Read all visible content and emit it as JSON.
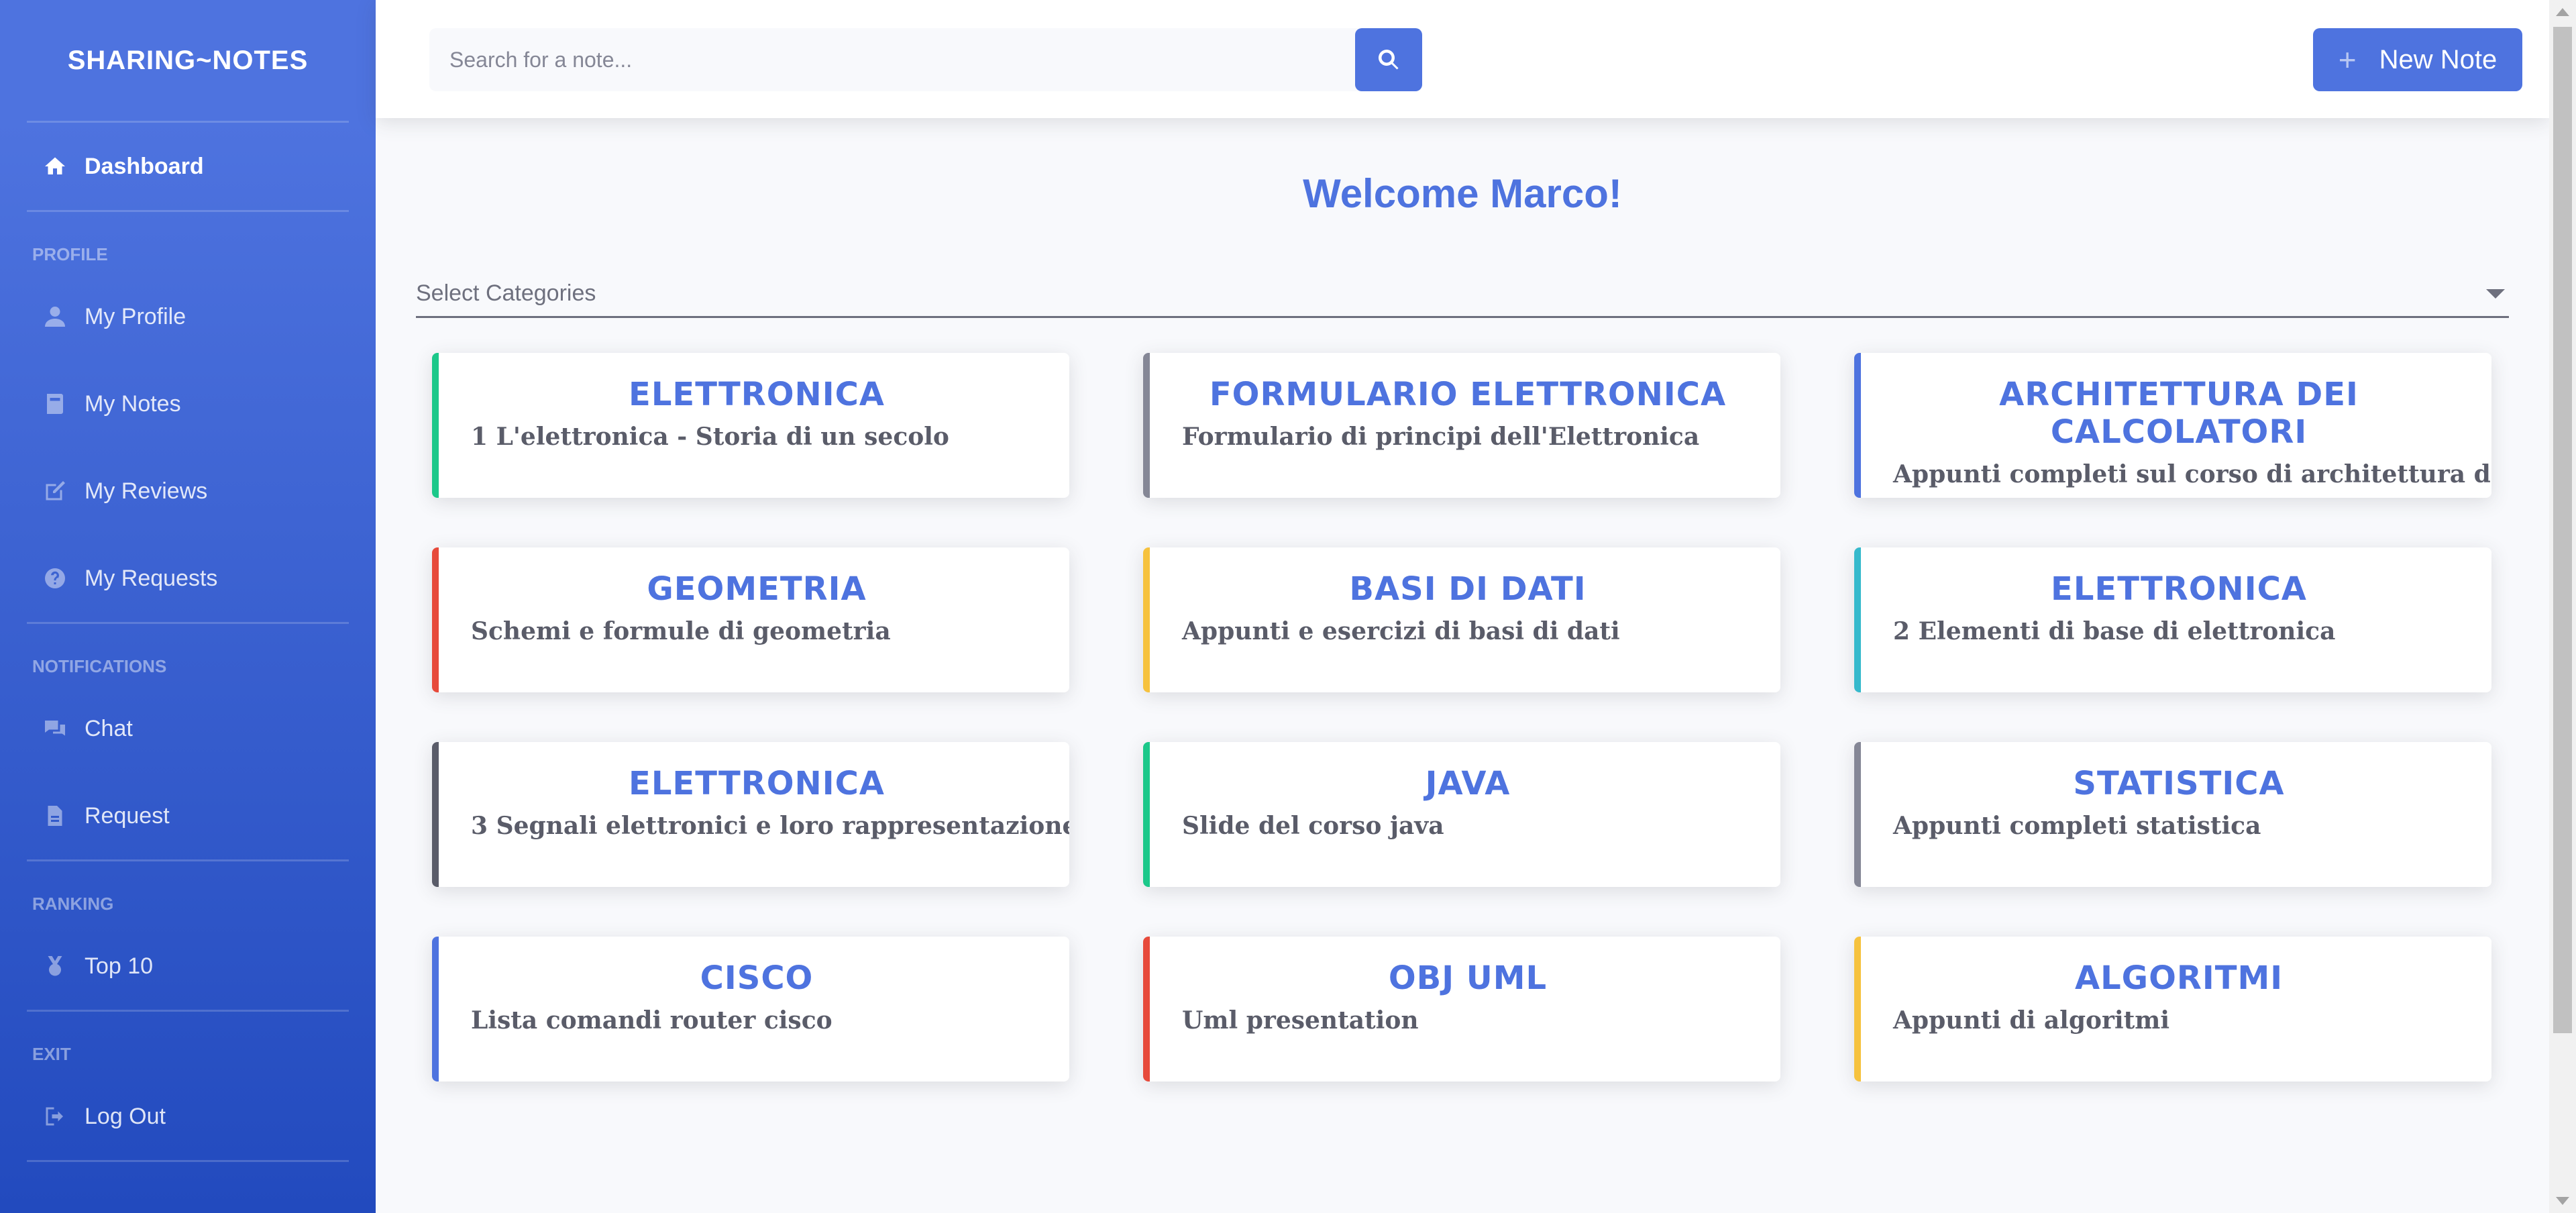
{
  "sidebar": {
    "brand": "SHARING~NOTES",
    "dashboard": {
      "label": "Dashboard",
      "icon": "home-icon"
    },
    "sections": [
      {
        "heading": "PROFILE"
      },
      {
        "heading": "NOTIFICATIONS"
      },
      {
        "heading": "RANKING"
      },
      {
        "heading": "EXIT"
      }
    ],
    "items": [
      {
        "label": "My Profile",
        "icon": "user-icon"
      },
      {
        "label": "My Notes",
        "icon": "book-icon"
      },
      {
        "label": "My Reviews",
        "icon": "edit-icon"
      },
      {
        "label": "My Requests",
        "icon": "question-circle-icon"
      },
      {
        "label": "Chat",
        "icon": "comments-icon"
      },
      {
        "label": "Request",
        "icon": "file-icon"
      },
      {
        "label": "Top 10",
        "icon": "medal-icon"
      },
      {
        "label": "Log Out",
        "icon": "sign-out-icon"
      }
    ]
  },
  "topbar": {
    "search_placeholder": "Search for a note...",
    "new_note_label": "New Note"
  },
  "main": {
    "welcome": "Welcome Marco!",
    "category_select": "Select Categories"
  },
  "cards": [
    {
      "title": "ELETTRONICA",
      "desc": "1 L'elettronica - Storia di un secolo",
      "accent": "#1cc88a"
    },
    {
      "title": "FORMULARIO ELETTRONICA",
      "desc": "Formulario di principi dell'Elettronica",
      "accent": "#858796"
    },
    {
      "title": "ARCHITETTURA DEI CALCOLATORI",
      "desc": "Appunti completi sul corso di architettura dei",
      "accent": "#4e73df"
    },
    {
      "title": "GEOMETRIA",
      "desc": "Schemi e formule di geometria",
      "accent": "#e74a3b"
    },
    {
      "title": "BASI DI DATI",
      "desc": "Appunti e esercizi di basi di dati",
      "accent": "#f6c23e"
    },
    {
      "title": "ELETTRONICA",
      "desc": "2 Elementi di base di elettronica",
      "accent": "#36b9cc"
    },
    {
      "title": "ELETTRONICA",
      "desc": "3 Segnali elettronici e loro rappresentazione",
      "accent": "#5a5c69"
    },
    {
      "title": "JAVA",
      "desc": "Slide del corso java",
      "accent": "#1cc88a"
    },
    {
      "title": "STATISTICA",
      "desc": "Appunti completi statistica",
      "accent": "#858796"
    },
    {
      "title": "CISCO",
      "desc": "Lista comandi router cisco",
      "accent": "#4e73df"
    },
    {
      "title": "OBJ UML",
      "desc": "Uml presentation",
      "accent": "#e74a3b"
    },
    {
      "title": "ALGORITMI",
      "desc": "Appunti di algoritmi",
      "accent": "#f6c23e"
    }
  ],
  "colors": {
    "primary": "#4e73df",
    "text": "#5a5c69"
  }
}
